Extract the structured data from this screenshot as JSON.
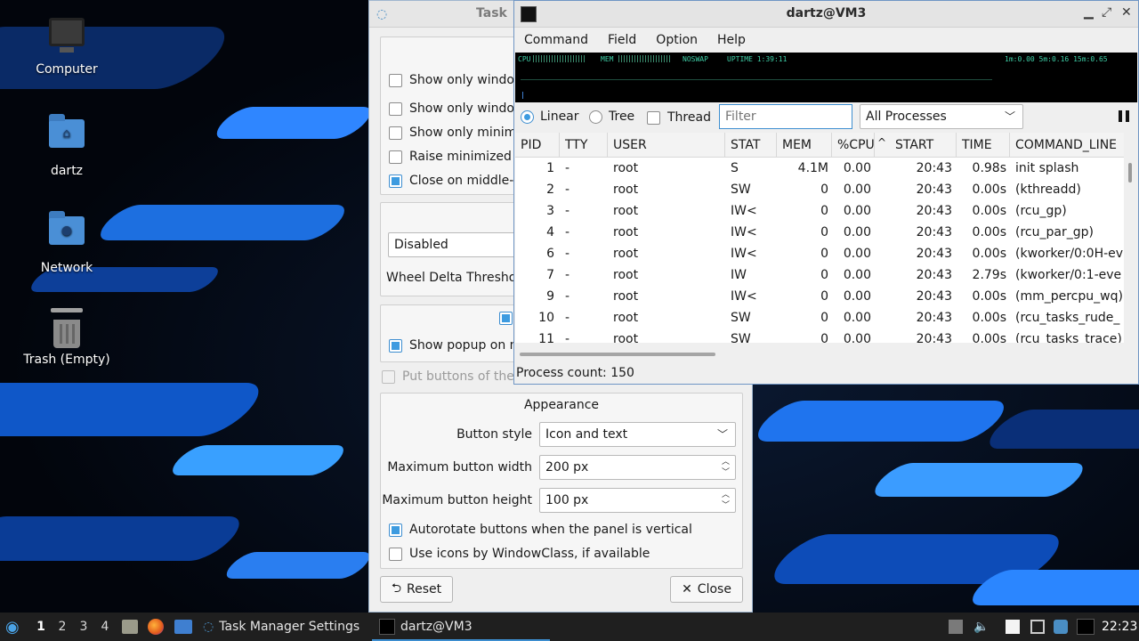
{
  "desktop": {
    "icons": [
      {
        "label": "Computer"
      },
      {
        "label": "dartz"
      },
      {
        "label": "Network"
      },
      {
        "label": "Trash (Empty)"
      }
    ]
  },
  "task_settings": {
    "title": "Task",
    "checkboxes": [
      {
        "label": "Show only window",
        "checked": false
      },
      {
        "label": "Show only window",
        "checked": false
      },
      {
        "label": "Show only minimi",
        "checked": false
      },
      {
        "label": "Raise minimized v",
        "checked": false
      },
      {
        "label": "Close on middle-c",
        "checked": true
      }
    ],
    "wheel_combo": "Disabled",
    "wheel_delta_label": "Wheel Delta Thresho",
    "popup_label": "Show popup on m",
    "put_buttons_label": "Put buttons of the",
    "appearance": {
      "title": "Appearance",
      "button_style_label": "Button style",
      "button_style_value": "Icon and text",
      "max_width_label": "Maximum button width",
      "max_width_value": "200 px",
      "max_height_label": "Maximum button height",
      "max_height_value": "100 px",
      "autorotate_label": "Autorotate buttons when the panel is vertical",
      "icons_windowclass_label": "Use icons by WindowClass, if available"
    },
    "reset_label": "Reset",
    "close_label": "Close"
  },
  "top_window": {
    "title": "dartz@VM3",
    "menu": [
      "Command",
      "Field",
      "Option",
      "Help"
    ],
    "graph": {
      "cpu": "CPU",
      "mem": "MEM",
      "noswap": "NOSWAP",
      "uptime": "UPTIME 1:39:11",
      "load": "1m:0.00 5m:0.16 15m:0.65"
    },
    "view_modes": {
      "linear": "Linear",
      "tree": "Tree",
      "thread": "Thread"
    },
    "filter_placeholder": "Filter",
    "process_scope": "All Processes",
    "columns": [
      "PID",
      "TTY",
      "USER",
      "STAT",
      "MEM",
      "%CPU",
      "START",
      "TIME",
      "COMMAND_LINE"
    ],
    "rows": [
      [
        "1",
        "-",
        "root",
        "S",
        "4.1M",
        "0.00",
        "20:43",
        "0.98s",
        "init splash"
      ],
      [
        "2",
        "-",
        "root",
        "SW",
        "0",
        "0.00",
        "20:43",
        "0.00s",
        "(kthreadd)"
      ],
      [
        "3",
        "-",
        "root",
        "IW<",
        "0",
        "0.00",
        "20:43",
        "0.00s",
        "(rcu_gp)"
      ],
      [
        "4",
        "-",
        "root",
        "IW<",
        "0",
        "0.00",
        "20:43",
        "0.00s",
        "(rcu_par_gp)"
      ],
      [
        "6",
        "-",
        "root",
        "IW<",
        "0",
        "0.00",
        "20:43",
        "0.00s",
        "(kworker/0:0H-ev"
      ],
      [
        "7",
        "-",
        "root",
        "IW",
        "0",
        "0.00",
        "20:43",
        "2.79s",
        "(kworker/0:1-eve"
      ],
      [
        "9",
        "-",
        "root",
        "IW<",
        "0",
        "0.00",
        "20:43",
        "0.00s",
        "(mm_percpu_wq)"
      ],
      [
        "10",
        "-",
        "root",
        "SW",
        "0",
        "0.00",
        "20:43",
        "0.00s",
        "(rcu_tasks_rude_"
      ],
      [
        "11",
        "-",
        "root",
        "SW",
        "0",
        "0.00",
        "20:43",
        "0.00s",
        "(rcu_tasks_trace)"
      ]
    ],
    "process_count": "Process count: 150"
  },
  "taskbar": {
    "workspaces": [
      "1",
      "2",
      "3",
      "4"
    ],
    "tasks": [
      {
        "label": "Task Manager Settings"
      },
      {
        "label": "dartz@VM3"
      }
    ],
    "clock": "22:23"
  }
}
